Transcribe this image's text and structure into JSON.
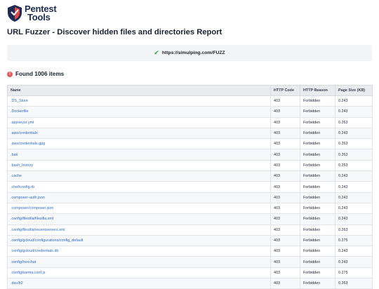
{
  "brand": {
    "line1": "Pentest",
    "line2": "Tools",
    "logo_icon": "shield-icon",
    "accent": "#1c2a55"
  },
  "report_title": "URL Fuzzer - Discover hidden files and directories Report",
  "target": {
    "icon": "check-icon",
    "url": "https://simulping.com/FUZZ"
  },
  "summary": {
    "icon": "alert-circle-icon",
    "text": "Found 1006 items"
  },
  "table": {
    "headers": [
      "Name",
      "HTTP Code",
      "HTTP Reason",
      "Page Size (KB)"
    ],
    "rows": [
      [
        ".DS_Store",
        "403",
        "Forbidden",
        "0.243"
      ],
      [
        ".Dockerfile",
        "403",
        "Forbidden",
        "0.243"
      ],
      [
        ".appveyor.yml",
        "403",
        "Forbidden",
        "0.263"
      ],
      [
        ".aws/credentials",
        "403",
        "Forbidden",
        "0.243"
      ],
      [
        ".aws/credentials.gpg",
        "403",
        "Forbidden",
        "0.263"
      ],
      [
        ".bak",
        "403",
        "Forbidden",
        "0.263"
      ],
      [
        ".bash_history",
        "403",
        "Forbidden",
        "0.263"
      ],
      [
        ".cache",
        "403",
        "Forbidden",
        "0.243"
      ],
      [
        ".chef/config.rb",
        "403",
        "Forbidden",
        "0.243"
      ],
      [
        ".composer-auth.json",
        "403",
        "Forbidden",
        "0.243"
      ],
      [
        ".composer/composer.json",
        "403",
        "Forbidden",
        "0.243"
      ],
      [
        ".config/filezilla/filezilla.xml",
        "403",
        "Forbidden",
        "0.243"
      ],
      [
        ".config/filezilla/recentservers.xml",
        "403",
        "Forbidden",
        "0.263"
      ],
      [
        ".config/gcloud/configurations/config_default",
        "403",
        "Forbidden",
        "0.275"
      ],
      [
        ".config/gcloud/credentials.db",
        "403",
        "Forbidden",
        "0.243"
      ],
      [
        ".config/hexchat",
        "403",
        "Forbidden",
        "0.243"
      ],
      [
        ".config/karma.conf.js",
        "403",
        "Forbidden",
        "0.275"
      ],
      [
        ".dav/b2",
        "403",
        "Forbidden",
        "0.263"
      ]
    ]
  }
}
